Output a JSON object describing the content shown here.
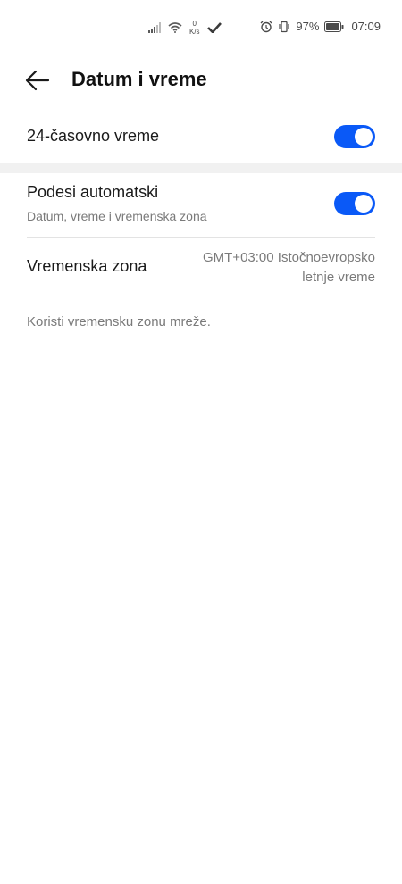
{
  "status_bar": {
    "speed_value": "0",
    "speed_unit": "K/s",
    "battery_percent": "97%",
    "time": "07:09",
    "icons": [
      "signal-icon",
      "wifi-icon",
      "check-icon",
      "alarm-icon",
      "vibrate-icon",
      "battery-icon"
    ]
  },
  "header": {
    "title": "Datum i vreme",
    "back_icon": "arrow-left-icon"
  },
  "settings": {
    "hour24": {
      "label": "24-časovno vreme",
      "enabled": true
    },
    "auto": {
      "label": "Podesi automatski",
      "sublabel": "Datum, vreme i vremenska zona",
      "enabled": true
    },
    "timezone": {
      "label": "Vremenska zona",
      "value_line1": "GMT+03:00 Istočnoevropsko",
      "value_line2": "letnje vreme"
    },
    "footnote": "Koristi vremensku zonu mreže."
  },
  "colors": {
    "toggle_on": "#0a59f7",
    "text_primary": "#1a1a1a",
    "text_secondary": "#7a7a7a"
  }
}
